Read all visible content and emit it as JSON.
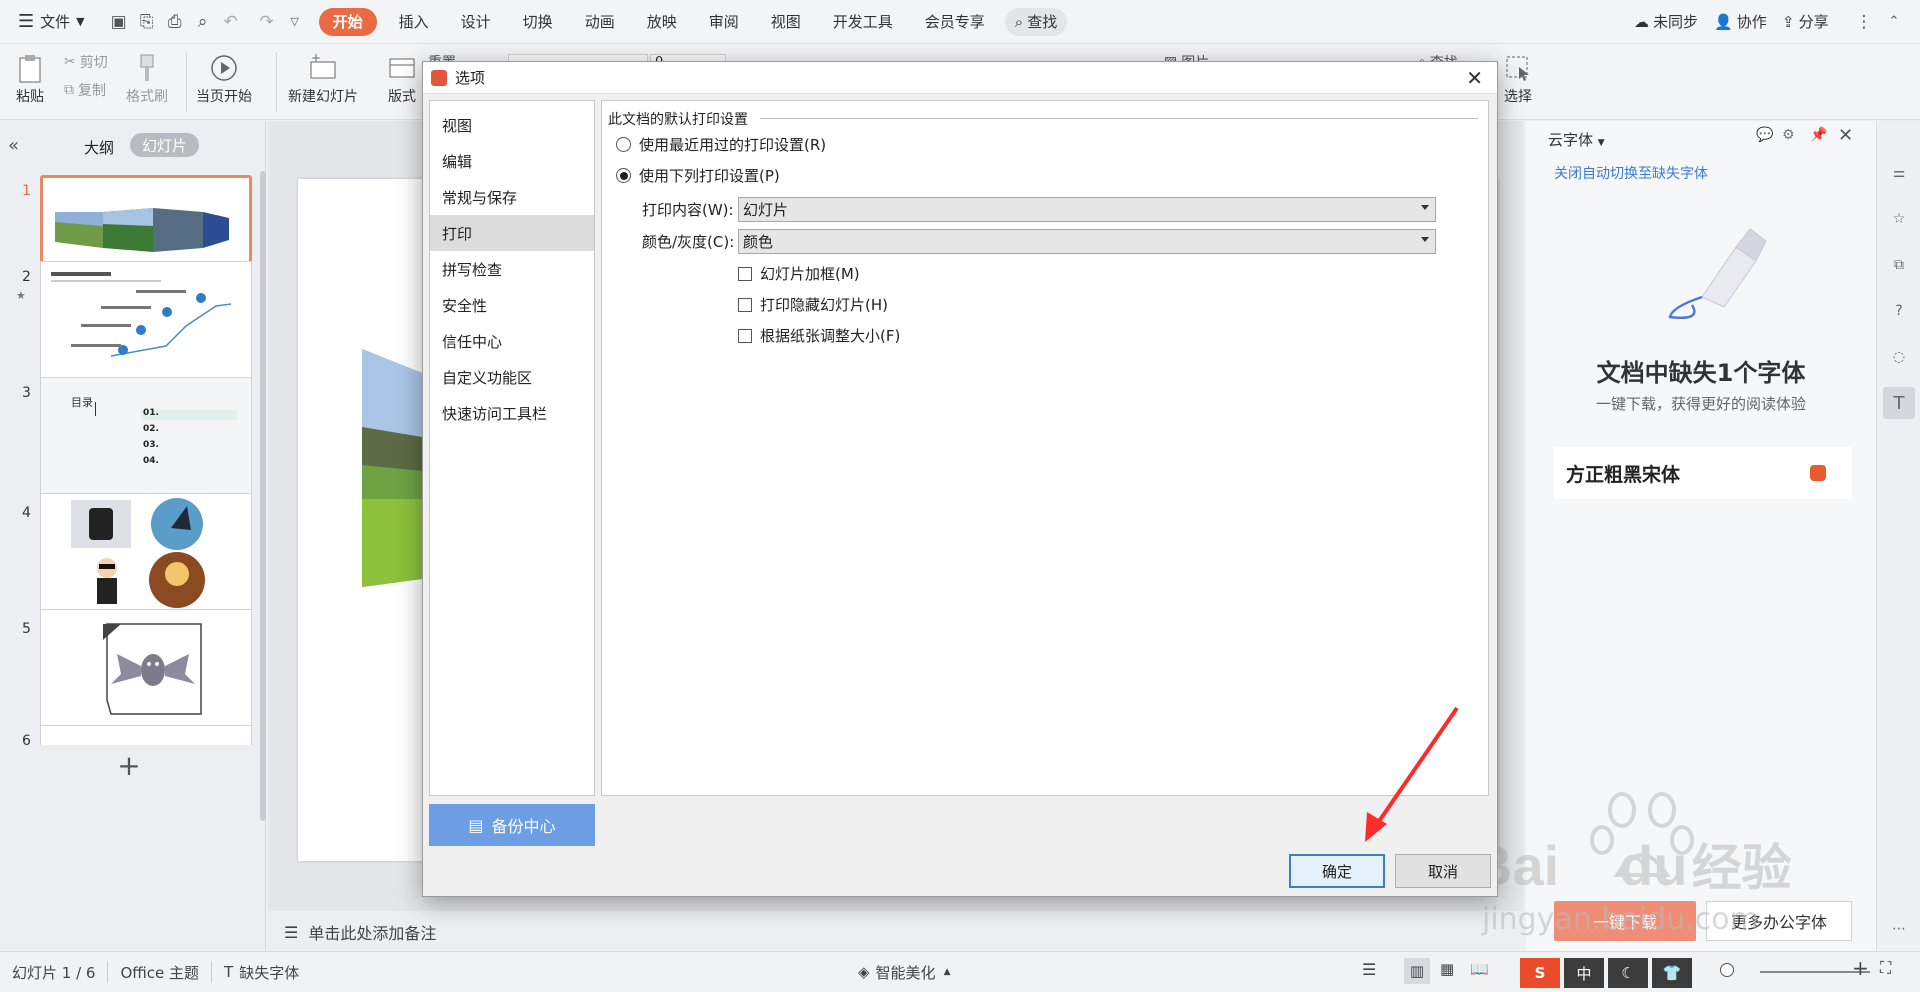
{
  "topbar": {
    "menu_label": "文件",
    "tabs": [
      "开始",
      "插入",
      "设计",
      "切换",
      "动画",
      "放映",
      "审阅",
      "视图",
      "开发工具",
      "会员专享"
    ],
    "search_label": "查找",
    "sync_label": "未同步",
    "collab_label": "协作",
    "share_label": "分享"
  },
  "ribbon": {
    "paste": "粘贴",
    "cut": "剪切",
    "copy": "复制",
    "format_painter": "格式刷",
    "from_current": "当页开始",
    "new_slide": "新建幻灯片",
    "layout": "版式",
    "reset": "重置",
    "font_size_value": "0",
    "picture": "图片",
    "find": "查找",
    "select": "选择"
  },
  "left_panel": {
    "outline_tab": "大纲",
    "slides_tab": "幻灯片",
    "slide_numbers": [
      "1",
      "2",
      "3",
      "4",
      "5",
      "6"
    ],
    "slide3_title": "目录",
    "slide3_items": [
      "01.",
      "02.",
      "03.",
      "04."
    ],
    "add_slide": "+"
  },
  "notes_placeholder": "单击此处添加备注",
  "dialog": {
    "title": "选项",
    "nav": [
      "视图",
      "编辑",
      "常规与保存",
      "打印",
      "拼写检查",
      "安全性",
      "信任中心",
      "自定义功能区",
      "快速访问工具栏"
    ],
    "active_nav": "打印",
    "backup_button": "备份中心",
    "section_title": "此文档的默认打印设置",
    "radio_recent": "使用最近用过的打印设置(R)",
    "radio_following": "使用下列打印设置(P)",
    "print_content_label": "打印内容(W):",
    "print_content_value": "幻灯片",
    "color_label": "颜色/灰度(C):",
    "color_value": "颜色",
    "chk_frame": "幻灯片加框(M)",
    "chk_hidden": "打印隐藏幻灯片(H)",
    "chk_fit": "根据纸张调整大小(F)",
    "ok_button": "确定",
    "cancel_button": "取消"
  },
  "right_panel": {
    "title": "云字体",
    "link": "关闭自动切换至缺失字体",
    "headline": "文档中缺失1个字体",
    "subline": "一键下载，获得更好的阅读体验",
    "font_name": "方正粗黑宋体",
    "download_button": "一键下载",
    "more_button": "更多办公字体"
  },
  "statusbar": {
    "slide_info": "幻灯片 1 / 6",
    "theme": "Office 主题",
    "missing_font": "缺失字体",
    "beautify": "智能美化"
  },
  "ime": {
    "chinese": "中"
  },
  "watermark": {
    "text1": "Bai",
    "text2": "du",
    "text3": "经验",
    "url": "jingyan.baidu.com"
  },
  "colors": {
    "accent": "#ea6a43",
    "link": "#3a7bd5",
    "backup_btn": "#6d9de3"
  }
}
